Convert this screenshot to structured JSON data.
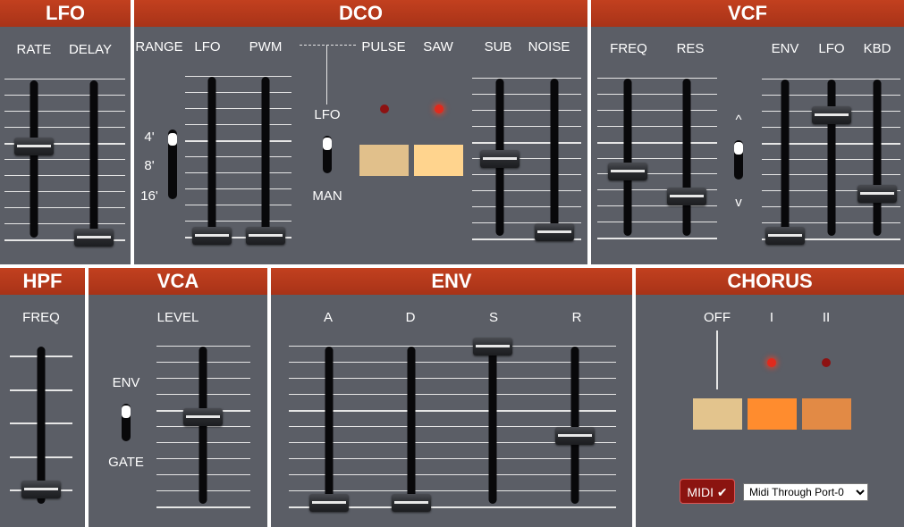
{
  "lfo": {
    "title": "LFO",
    "rate": "RATE",
    "delay": "DELAY"
  },
  "dco": {
    "title": "DCO",
    "range": "RANGE",
    "lfo": "LFO",
    "pwm": "PWM",
    "pulse": "PULSE",
    "saw": "SAW",
    "sub": "SUB",
    "noise": "NOISE",
    "range_4": "4'",
    "range_8": "8'",
    "range_16": "16'",
    "pwm_lfo": "LFO",
    "pwm_man": "MAN"
  },
  "vcf": {
    "title": "VCF",
    "freq": "FREQ",
    "res": "RES",
    "env": "ENV",
    "lfo": "LFO",
    "kbd": "KBD",
    "pol_pos": "^",
    "pol_neg": "v"
  },
  "hpf": {
    "title": "HPF",
    "freq": "FREQ"
  },
  "vca": {
    "title": "VCA",
    "level": "LEVEL",
    "env": "ENV",
    "gate": "GATE"
  },
  "env": {
    "title": "ENV",
    "a": "A",
    "d": "D",
    "s": "S",
    "r": "R"
  },
  "chorus": {
    "title": "CHORUS",
    "off": "OFF",
    "i": "I",
    "ii": "II"
  },
  "midi": {
    "label": "MIDI",
    "check": "✔",
    "port": "Midi Through Port-0",
    "options": [
      "Midi Through Port-0"
    ]
  },
  "colors": {
    "panel": "#5b5e66",
    "header": "#b33a1c",
    "led_on": "#e02a1d",
    "led_off": "#8d1212",
    "pulse_btn": "#e1c08b",
    "saw_btn": "#ffd48e",
    "chorus_off_btn": "#e3c48d",
    "chorus_i_btn": "#ff8c2e",
    "chorus_ii_btn": "#e28a45"
  },
  "state": {
    "lfo_rate": 0.58,
    "lfo_delay": 0.0,
    "dco_range": "4'",
    "dco_lfo": 0.0,
    "dco_pwm": 0.0,
    "dco_pwm_mode": "LFO",
    "dco_pulse": false,
    "dco_saw": true,
    "dco_sub": 0.49,
    "dco_noise": 0.02,
    "vcf_freq": 0.41,
    "vcf_res": 0.25,
    "vcf_env_polarity": "^",
    "vcf_env": 0.0,
    "vcf_lfo": 0.77,
    "vcf_kbd": 0.27,
    "hpf_freq": 0.0,
    "vca_mode": "ENV",
    "vca_level": 0.55,
    "env_a": 0.0,
    "env_d": 0.0,
    "env_s": 1.0,
    "env_r": 0.43,
    "chorus": "OFF"
  }
}
